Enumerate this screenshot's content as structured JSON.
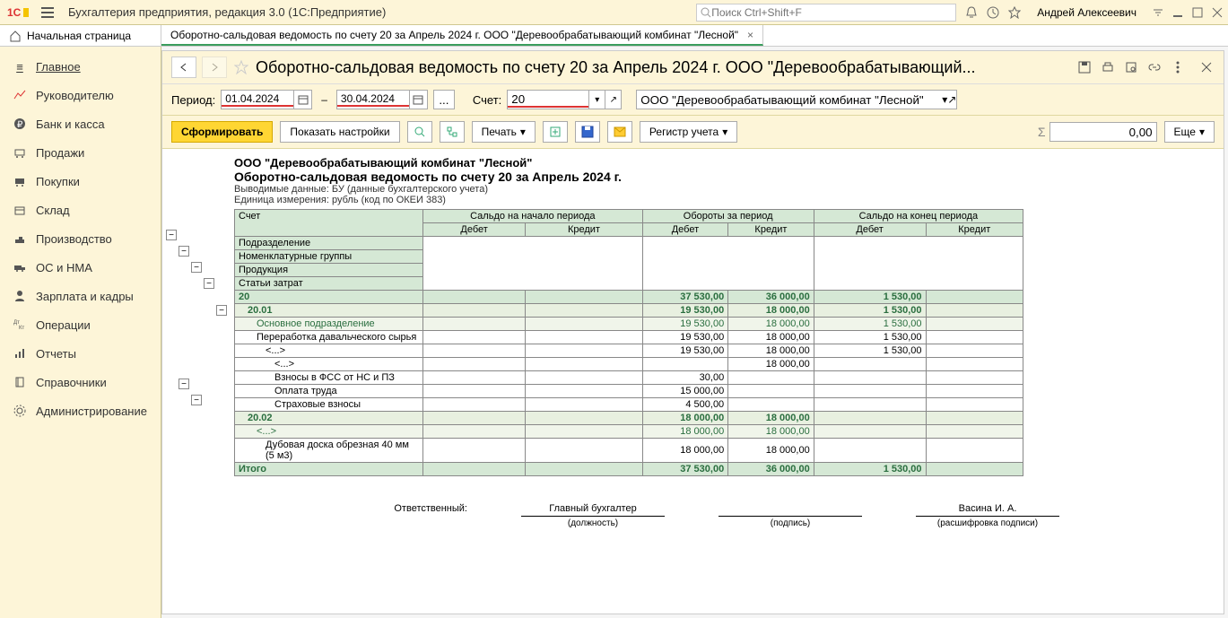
{
  "topbar": {
    "app_title": "Бухгалтерия предприятия, редакция 3.0  (1С:Предприятие)",
    "search_placeholder": "Поиск Ctrl+Shift+F",
    "user": "Андрей Алексеевич"
  },
  "tabs": {
    "home": "Начальная страница",
    "active": "Оборотно-сальдовая ведомость по счету 20 за Апрель 2024 г. ООО \"Деревообрабатывающий комбинат \"Лесной\""
  },
  "sidebar": {
    "items": [
      {
        "label": "Главное"
      },
      {
        "label": "Руководителю"
      },
      {
        "label": "Банк и касса"
      },
      {
        "label": "Продажи"
      },
      {
        "label": "Покупки"
      },
      {
        "label": "Склад"
      },
      {
        "label": "Производство"
      },
      {
        "label": "ОС и НМА"
      },
      {
        "label": "Зарплата и кадры"
      },
      {
        "label": "Операции"
      },
      {
        "label": "Отчеты"
      },
      {
        "label": "Справочники"
      },
      {
        "label": "Администрирование"
      }
    ]
  },
  "page": {
    "title": "Оборотно-сальдовая ведомость по счету 20 за Апрель 2024 г. ООО \"Деревообрабатывающий..."
  },
  "params": {
    "period_label": "Период:",
    "date_from": "01.04.2024",
    "date_to": "30.04.2024",
    "account_label": "Счет:",
    "account": "20",
    "org": "ООО \"Деревообрабатывающий комбинат \"Лесной\""
  },
  "toolbar": {
    "form": "Сформировать",
    "show_settings": "Показать настройки",
    "print": "Печать",
    "register": "Регистр учета",
    "sum_value": "0,00",
    "more": "Еще"
  },
  "report": {
    "org": "ООО \"Деревообрабатывающий комбинат \"Лесной\"",
    "title": "Оборотно-сальдовая ведомость по счету 20 за Апрель 2024 г.",
    "sub1": "Выводимые данные: БУ (данные бухгалтерского учета)",
    "sub2": "Единица измерения: рубль (код по ОКЕИ 383)",
    "headers": {
      "account": "Счет",
      "subdiv": "Подразделение",
      "nomgroup": "Номенклатурные группы",
      "product": "Продукция",
      "cost": "Статьи затрат",
      "start": "Сальдо на начало периода",
      "turn": "Обороты за период",
      "end": "Сальдо на конец периода",
      "debit": "Дебет",
      "credit": "Кредит",
      "total": "Итого"
    },
    "rows": [
      {
        "lvl": 0,
        "label": "20",
        "d_turn": "37 530,00",
        "c_turn": "36 000,00",
        "d_end": "1 530,00"
      },
      {
        "lvl": 1,
        "label": "20.01",
        "d_turn": "19 530,00",
        "c_turn": "18 000,00",
        "d_end": "1 530,00",
        "indent": 1
      },
      {
        "lvl": 2,
        "label": "Основное подразделение",
        "d_turn": "19 530,00",
        "c_turn": "18 000,00",
        "d_end": "1 530,00",
        "indent": 2
      },
      {
        "lvl": 3,
        "label": "Переработка давальческого сырья",
        "d_turn": "19 530,00",
        "c_turn": "18 000,00",
        "d_end": "1 530,00",
        "indent": 2
      },
      {
        "lvl": 3,
        "label": "<...>",
        "d_turn": "19 530,00",
        "c_turn": "18 000,00",
        "d_end": "1 530,00",
        "indent": 3
      },
      {
        "lvl": 3,
        "label": "<...>",
        "c_turn": "18 000,00",
        "indent": 4
      },
      {
        "lvl": 3,
        "label": "Взносы в ФСС от НС и ПЗ",
        "d_turn": "30,00",
        "indent": 4
      },
      {
        "lvl": 3,
        "label": "Оплата труда",
        "d_turn": "15 000,00",
        "indent": 4
      },
      {
        "lvl": 3,
        "label": "Страховые взносы",
        "d_turn": "4 500,00",
        "indent": 4
      },
      {
        "lvl": 1,
        "label": "20.02",
        "d_turn": "18 000,00",
        "c_turn": "18 000,00",
        "indent": 1
      },
      {
        "lvl": 2,
        "label": "<...>",
        "d_turn": "18 000,00",
        "c_turn": "18 000,00",
        "indent": 2
      },
      {
        "lvl": 3,
        "label": "Дубовая доска обрезная 40 мм (5 м3)",
        "d_turn": "18 000,00",
        "c_turn": "18 000,00",
        "indent": 3
      }
    ],
    "total": {
      "d_turn": "37 530,00",
      "c_turn": "36 000,00",
      "d_end": "1 530,00"
    }
  },
  "signatures": {
    "responsible": "Ответственный:",
    "chief": "Главный бухгалтер",
    "position": "(должность)",
    "sign": "(подпись)",
    "name": "Васина И. А.",
    "decode": "(расшифровка подписи)"
  }
}
